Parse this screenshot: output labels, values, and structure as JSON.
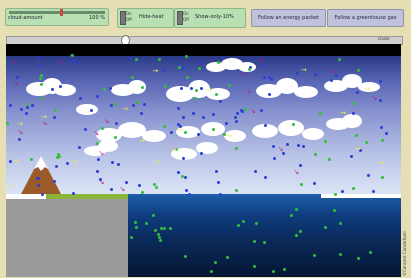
{
  "controls": {
    "slider": {
      "label": "cloud-amount",
      "value": "100 %",
      "level": 0.55
    },
    "toggles": [
      {
        "on": "On",
        "off": "Off",
        "label": "Hide-heat"
      },
      {
        "on": "On",
        "off": "Off",
        "label": "Show-only-10%"
      }
    ],
    "buttons": {
      "energy": "Follow an energy packet",
      "greenhouse": "Follow a greenhouse gas"
    }
  },
  "view": {
    "closer_label": "closer"
  },
  "credit": "©Concord Consortium",
  "colors": {
    "space": "#000000",
    "sky_top": "#2b3a86",
    "sky_bottom": "#dfe8f7",
    "cloud": "#ffffff",
    "ocean": "#0f3e80",
    "ground": "#9a9a9a",
    "grass": "#8bb43d",
    "mountain": "#9a5a2a",
    "energy_packet": "#f2e94e",
    "greenhouse_gas": "#c2186b",
    "co2": "#2c3fd6",
    "water_vapor": "#2fbf3a"
  }
}
